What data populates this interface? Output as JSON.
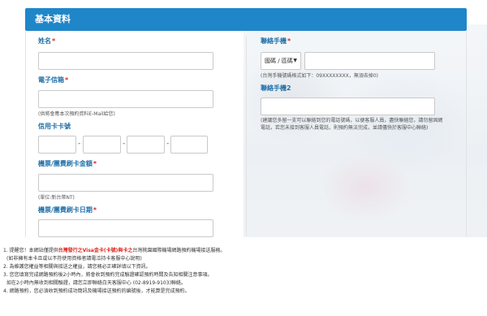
{
  "header": {
    "title": "基本資料"
  },
  "left": {
    "name": {
      "label": "姓名",
      "required": "*",
      "value": ""
    },
    "email": {
      "label": "電子信箱",
      "required": "*",
      "value": "",
      "note": "(供將會應本次預約資料E-Mail給您)"
    },
    "card_number": {
      "label": "信用卡卡號",
      "dash": "-",
      "values": [
        "",
        "",
        "",
        ""
      ]
    },
    "amount": {
      "label": "機票/團費刷卡金額",
      "required": "*",
      "value": "",
      "note": "(單位:新台幣NT)"
    },
    "date": {
      "label": "機票/團費刷卡日期",
      "required": "*",
      "value": ""
    }
  },
  "right": {
    "phone": {
      "label": "聯絡手機",
      "required": "*",
      "select_value": "國碼 / 區碼",
      "caret": "▼",
      "value": "",
      "note": "(台灣手機號碼格式如下：09XXXXXXXX，無須去掉0)"
    },
    "phone2": {
      "label": "聯絡手機2",
      "value": "",
      "note_lines": [
        "(建議您多留一支可以聯絡到您的電話號碼，以便客服人員，盡快聯絡您，請勿留固網",
        "電話，若您未接到客服人員電話，則預約無法完成，並請儘快於客服中心聯絡)"
      ]
    }
  },
  "notices": {
    "line1_pre": "1. 提醒您！本網站僅提供",
    "line1_hl": "台灣發行之Visa金卡(卡號)與卡之",
    "line1_post": "台灣桃園國際機場網路預約機場接送服務。",
    "line2": "(如非擁有本卡且或以不符使用資格者請電洽持卡客服中心說明)",
    "line3": "2. 為維護您權益等相關與接送之權益，請您務必正確詳填以下資訊。",
    "line4": "3. 您您填寫完成網路預約後2小時內，將會收到預約完成驗證確認預約時間及告知相關注意事項。",
    "line5": "如在2小時內無收到相關驗證，請您立即聯絡白天客服中心 (02-8919-9103)聯絡。",
    "line6": "4. 網路預約，您必須收到預約成功簡訊及機場接送預約的編號後，才能算是完成預約。"
  }
}
